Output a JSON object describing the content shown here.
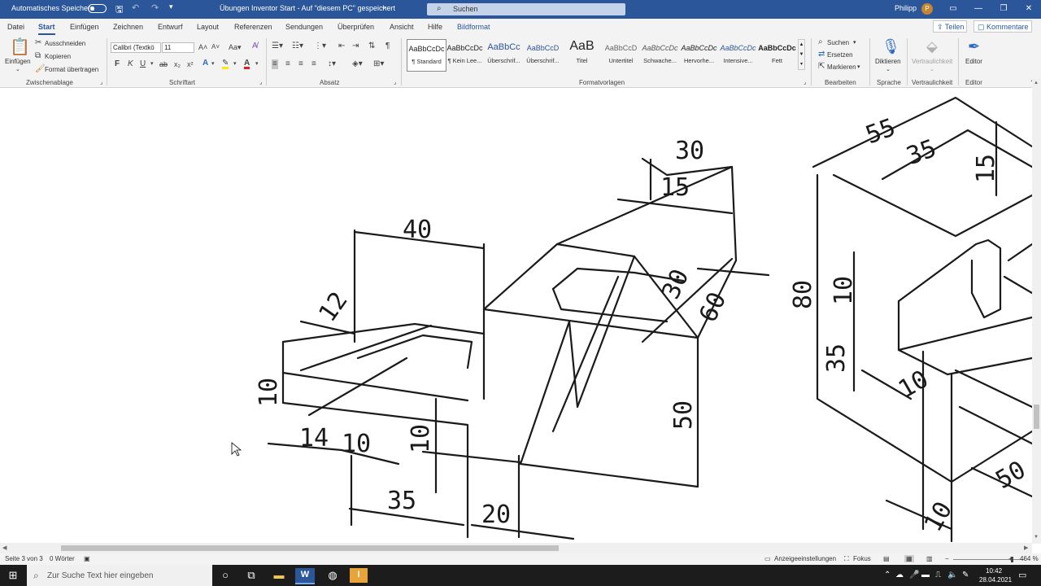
{
  "titlebar": {
    "autosave_label": "Automatisches Speichern",
    "doc_title": "Übungen Inventor Start - Auf \"diesem PC\" gespeichert",
    "doc_title_chevron": "⌄",
    "search_placeholder": "Suchen",
    "user_name": "Philipp",
    "user_initial": "P"
  },
  "menu": {
    "tabs": [
      "Datei",
      "Start",
      "Einfügen",
      "Zeichnen",
      "Entwurf",
      "Layout",
      "Referenzen",
      "Sendungen",
      "Überprüfen",
      "Ansicht",
      "Hilfe",
      "Bildformat"
    ],
    "share": "Teilen",
    "comments": "Kommentare"
  },
  "ribbon": {
    "clipboard": {
      "paste": "Einfügen",
      "cut": "Ausschneiden",
      "copy": "Kopieren",
      "format_painter": "Format übertragen",
      "group": "Zwischenablage"
    },
    "font": {
      "family": "Calibri (Textkö",
      "size": "11",
      "bold": "F",
      "italic": "K",
      "underline": "U",
      "group": "Schriftart"
    },
    "paragraph": {
      "group": "Absatz"
    },
    "styles": {
      "items": [
        {
          "preview": "AaBbCcDc",
          "name": "¶ Standard"
        },
        {
          "preview": "AaBbCcDc",
          "name": "¶ Kein Lee..."
        },
        {
          "preview": "AaBbCc",
          "name": "Überschrif..."
        },
        {
          "preview": "AaBbCcD",
          "name": "Überschrif..."
        },
        {
          "preview": "AaB",
          "name": "Titel"
        },
        {
          "preview": "AaBbCcD",
          "name": "Untertitel"
        },
        {
          "preview": "AaBbCcDc",
          "name": "Schwache..."
        },
        {
          "preview": "AaBbCcDc",
          "name": "Hervorhe..."
        },
        {
          "preview": "AaBbCcDc",
          "name": "Intensive..."
        },
        {
          "preview": "AaBbCcDc",
          "name": "Fett"
        }
      ],
      "group": "Formatvorlagen"
    },
    "editing": {
      "find": "Suchen",
      "replace": "Ersetzen",
      "select": "Markieren",
      "group": "Bearbeiten"
    },
    "voice": {
      "dictate": "Diktieren",
      "group": "Sprache"
    },
    "sensitivity": {
      "label": "Vertraulichkeit",
      "group": "Vertraulichkeit"
    },
    "editor": {
      "label": "Editor",
      "group": "Editor"
    }
  },
  "drawing": {
    "dims": [
      "30",
      "15",
      "40",
      "12",
      "30",
      "60",
      "10",
      "14",
      "10",
      "10",
      "50",
      "35",
      "20",
      "55",
      "35",
      "15",
      "80",
      "10",
      "35",
      "10",
      "50",
      "10"
    ]
  },
  "status": {
    "page": "Seite 3 von 3",
    "words": "0 Wörter",
    "display_settings": "Anzeigeeinstellungen",
    "focus": "Fokus",
    "zoom": "464 %",
    "zoom_level": 0.82
  },
  "taskbar": {
    "search_placeholder": "Zur Suche Text hier eingeben",
    "time": "10:42",
    "date": "28.04.2021"
  },
  "colors": {
    "accent": "#2b579a",
    "taskbar": "#1c1c1c"
  }
}
